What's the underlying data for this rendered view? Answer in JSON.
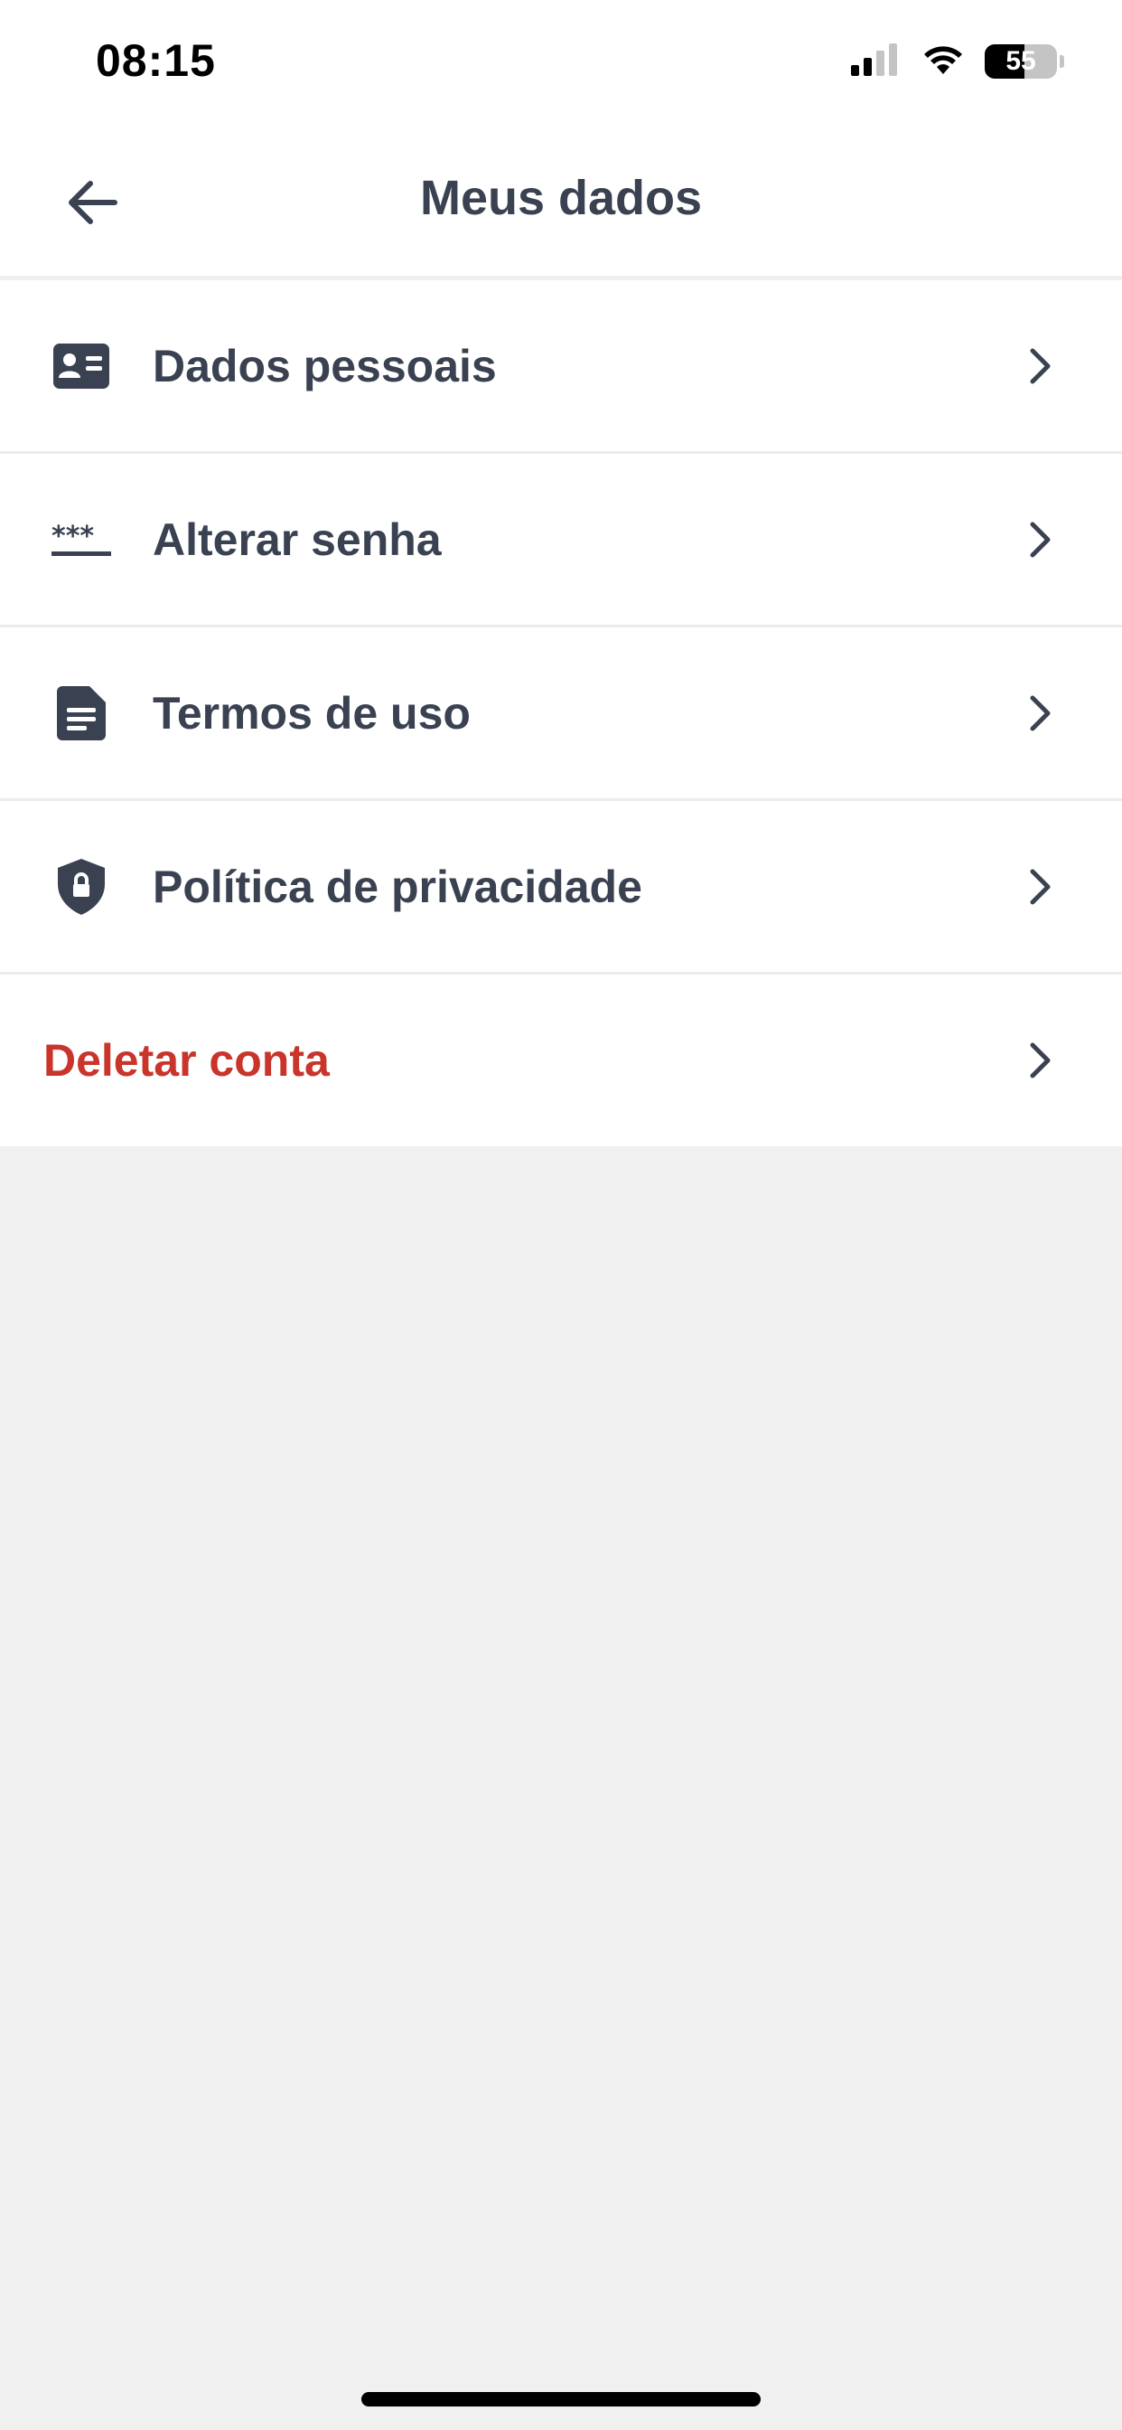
{
  "status_bar": {
    "time": "08:15",
    "battery_level": "55",
    "battery_fraction": 0.55,
    "icons": [
      "signal-icon",
      "wifi-icon",
      "battery-icon"
    ]
  },
  "header": {
    "title": "Meus dados",
    "back_icon": "arrow-left-icon"
  },
  "menu": {
    "items": [
      {
        "label": "Dados pessoais",
        "icon": "id-card-icon"
      },
      {
        "label": "Alterar senha",
        "icon": "password-icon"
      },
      {
        "label": "Termos de uso",
        "icon": "document-icon"
      },
      {
        "label": "Política de privacidade",
        "icon": "shield-lock-icon"
      },
      {
        "label": "Deletar conta",
        "icon": "",
        "danger": true
      }
    ]
  },
  "colors": {
    "text_primary": "#3a4252",
    "danger": "#c9342b",
    "background": "#f0f0f0",
    "surface": "#ffffff",
    "divider": "#ececec"
  }
}
